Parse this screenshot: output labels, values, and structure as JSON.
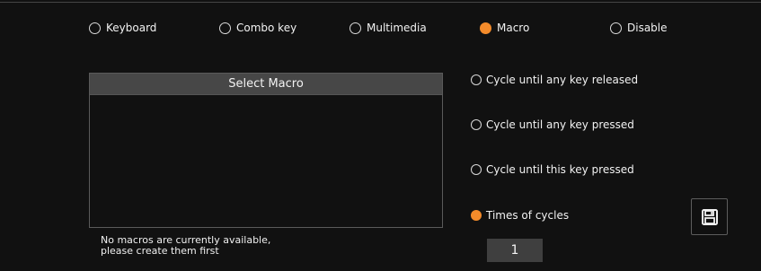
{
  "modes": [
    {
      "label": "Keyboard",
      "checked": false
    },
    {
      "label": "Combo key",
      "checked": false
    },
    {
      "label": "Multimedia",
      "checked": false
    },
    {
      "label": "Macro",
      "checked": true
    },
    {
      "label": "Disable",
      "checked": false
    }
  ],
  "macro_list": {
    "header": "Select Macro",
    "empty_message_line1": "No macros are currently available,",
    "empty_message_line2": "please create them first"
  },
  "cycle_options": [
    {
      "label": "Cycle until any key released",
      "checked": false
    },
    {
      "label": "Cycle until any key pressed",
      "checked": false
    },
    {
      "label": "Cycle until this key pressed",
      "checked": false
    },
    {
      "label": "Times of cycles",
      "checked": true
    }
  ],
  "cycles_count": "1",
  "icons": {
    "save": "save-icon"
  },
  "colors": {
    "background": "#111111",
    "accent": "#f38b2b",
    "panel_header": "#474747",
    "input_background": "#3f3f3f"
  }
}
